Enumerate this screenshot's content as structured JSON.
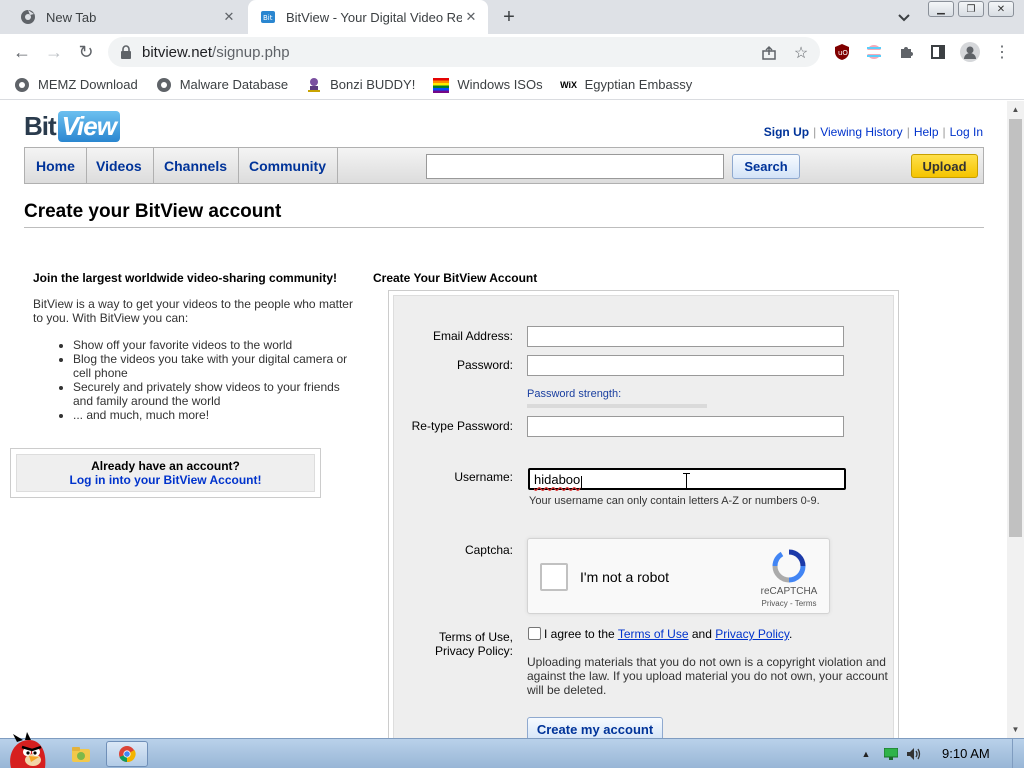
{
  "browser": {
    "tabs": [
      {
        "title": "New Tab",
        "active": false
      },
      {
        "title": "BitView - Your Digital Video Re",
        "active": true
      }
    ],
    "address": {
      "host": "bitview.net",
      "path": "/signup.php"
    },
    "bookmarks": [
      {
        "label": "MEMZ Download",
        "icon": "globe-icon"
      },
      {
        "label": "Malware Database",
        "icon": "globe-icon"
      },
      {
        "label": "Bonzi BUDDY!",
        "icon": "bonzi-icon"
      },
      {
        "label": "Windows ISOs",
        "icon": "windows-flag-icon"
      },
      {
        "label": "Egyptian Embassy",
        "icon": "wix-icon"
      }
    ],
    "window_controls": [
      "minimize",
      "maximize",
      "close"
    ]
  },
  "site": {
    "logo_bit": "Bit",
    "logo_view": "View",
    "toplinks": {
      "signup": "Sign Up",
      "history": "Viewing History",
      "help": "Help",
      "login": "Log In",
      "separator": "|"
    },
    "nav": [
      "Home",
      "Videos",
      "Channels",
      "Community"
    ],
    "search_button": "Search",
    "upload_button": "Upload"
  },
  "page": {
    "title": "Create your BitView account",
    "left": {
      "lead": "Join the largest worldwide video-sharing community!",
      "intro": "BitView is a way to get your videos to the people who matter to you. With BitView you can:",
      "bullets": [
        "Show off your favorite videos to the world",
        "Blog the videos you take with your digital camera or cell phone",
        "Securely and privately show videos to your friends and family around the world",
        "... and much, much more!"
      ],
      "login_question": "Already have an account?",
      "login_link": "Log in into your BitView Account!"
    },
    "form": {
      "heading": "Create Your BitView Account",
      "email_label": "Email Address:",
      "password_label": "Password:",
      "password_strength": "Password strength:",
      "retype_label": "Re-type Password:",
      "username_label": "Username:",
      "username_value": "hidaboo",
      "username_hint": "Your username can only contain letters A-Z or numbers 0-9.",
      "captcha_label": "Captcha:",
      "recaptcha_text": "I'm not a robot",
      "recaptcha_brand": "reCAPTCHA",
      "recaptcha_links": "Privacy - Terms",
      "terms_label_1": "Terms of Use,",
      "terms_label_2": "Privacy Policy:",
      "agree_prefix": "I agree to the ",
      "terms_link": "Terms of Use",
      "and": " and ",
      "privacy_link": "Privacy Policy",
      "period": ".",
      "legal_notice": "Uploading materials that you do not own is a copyright violation and against the law. If you upload material you do not own, your account will be deleted.",
      "submit": "Create my account"
    }
  },
  "taskbar": {
    "clock": "9:10 AM"
  },
  "colors": {
    "link_blue": "#0033cc",
    "nav_blue": "#003399",
    "upload_yellow": "#f5c400",
    "panel_gray": "#eeeeee"
  }
}
